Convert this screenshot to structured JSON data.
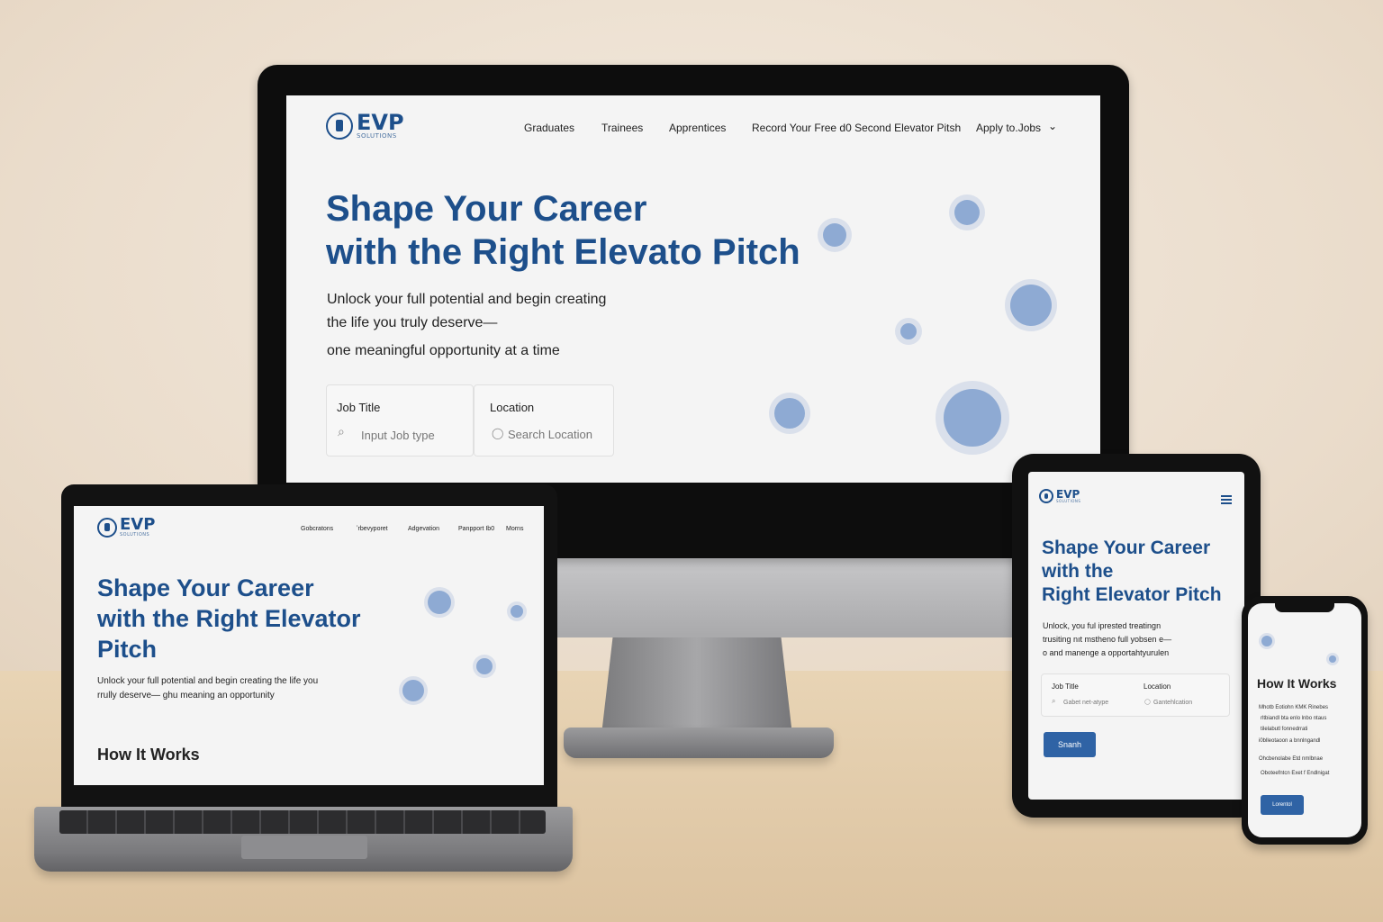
{
  "desktop": {
    "logo": {
      "text": "EVP",
      "sub": "SOLUTIONS"
    },
    "nav": [
      {
        "label": "Graduates"
      },
      {
        "label": "Trainees"
      },
      {
        "label": "Apprentices"
      },
      {
        "label": "Record Your Free d0 Second Elevator Pitsh"
      },
      {
        "label": "Apply to.Jobs"
      }
    ],
    "hero": {
      "title_line1": "Shape Your Career",
      "title_line2": "with the Right Elevato Pitch",
      "sub_line1": "Unlock your full potential and begin creating",
      "sub_line2": "the life you truly deserve—",
      "sub_line3": "one meaningful opportunity at a time"
    },
    "search": {
      "job_label": "Job Title",
      "job_placeholder": "Input Job type",
      "location_label": "Location",
      "location_placeholder": "Search Location"
    }
  },
  "laptop": {
    "logo": {
      "text": "EVP",
      "sub": "SOLUTIONS"
    },
    "nav": [
      {
        "label": "Gobcratons"
      },
      {
        "label": "ʼrbevyporet"
      },
      {
        "label": "Adgevation"
      },
      {
        "label": "Panpport Ib0"
      },
      {
        "label": "Morns"
      }
    ],
    "hero": {
      "title_line1": "Shape Your Career",
      "title_line2": "with the Right Elevator",
      "title_line3": "Pitch",
      "sub_line1": "Unlock your full potential and begin creating the life you",
      "sub_line2": "rrully deserve— ɡhu meaning an opportunity"
    },
    "section_title": "How It Works"
  },
  "tablet": {
    "logo": {
      "text": "EVP",
      "sub": "SOLUTIONS"
    },
    "hero": {
      "title_line1": "Shape Your Career",
      "title_line2": "with the",
      "title_line3": "Right Elevator Pitch",
      "sub_line1": "Unlock, you ful iprested treatingn",
      "sub_line2": "trusiting nıt mstheno full yobsen e—",
      "sub_line3": "o and manenge a opportahtyurulen"
    },
    "search": {
      "job_label": "Job Title",
      "job_placeholder": "Gabet net-atype",
      "location_label": "Location",
      "location_placeholder": "Gantehlcation"
    },
    "button_label": "Snanh"
  },
  "phone": {
    "section_title": "How It Works",
    "lines": [
      "Mhotb Eotiohn KMK Rinebes",
      "rltbiandl bta enlo lnbo ntaus",
      "tilelabutl fonnedrrati",
      "i0blleotaoon a bnnlngandl"
    ],
    "line5": "Ohcbenolabe Etd nmlbnae",
    "line6": "Oboteefntcn Exet f Endlnigat",
    "button_label": "Lorentol"
  },
  "colors": {
    "brand_blue": "#1d4f8b",
    "button_blue": "#2f63a5",
    "bubble_blue": "#8eaad3"
  }
}
